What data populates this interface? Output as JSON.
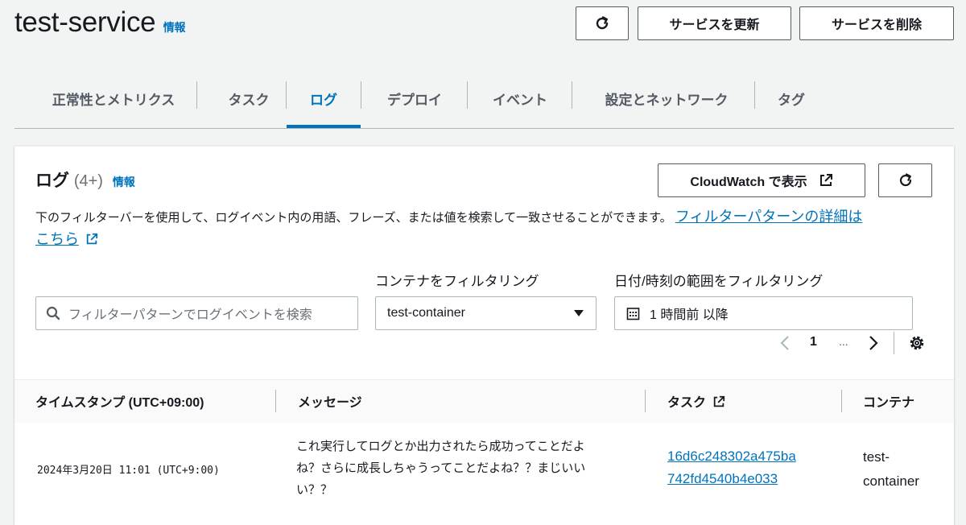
{
  "header": {
    "title": "test-service",
    "info": "情報",
    "update_button": "サービスを更新",
    "delete_button": "サービスを削除"
  },
  "tabs": [
    {
      "label": "正常性とメトリクス",
      "active": false
    },
    {
      "label": "タスク",
      "active": false
    },
    {
      "label": "ログ",
      "active": true
    },
    {
      "label": "デプロイ",
      "active": false
    },
    {
      "label": "イベント",
      "active": false
    },
    {
      "label": "設定とネットワーク",
      "active": false
    },
    {
      "label": "タグ",
      "active": false
    }
  ],
  "logs": {
    "title": "ログ",
    "count": "(4+)",
    "info": "情報",
    "cloudwatch_button": "CloudWatch で表示",
    "description": "下のフィルターバーを使用して、ログイベント内の用語、フレーズ、または値を検索して一致させることができます。",
    "details_link_part1": "フィルターパターンの詳細は",
    "details_link_part2": "こちら",
    "search_placeholder": "フィルターパターンでログイベントを検索",
    "container_filter_label": "コンテナをフィルタリング",
    "container_filter_value": "test-container",
    "date_filter_label": "日付/時刻の範囲をフィルタリング",
    "date_filter_value": "1 時間前 以降",
    "pagination": {
      "current_page": "1",
      "ellipsis": "..."
    }
  },
  "table": {
    "columns": [
      "タイムスタンプ (UTC+09:00)",
      "メッセージ",
      "タスク",
      "コンテナ"
    ],
    "rows": [
      {
        "timestamp": "2024年3月20日 11:01 (UTC+9:00)",
        "message_lines": [
          "これ実行してログとか出力されたら成功ってことだよ",
          "ね？さらに成長しちゃうってことだよね？？まじいい",
          "い？？"
        ],
        "task_lines": [
          "16d6c248302a475ba",
          "742fd4540b4e033"
        ],
        "container_lines": [
          "test-",
          "container"
        ]
      }
    ]
  },
  "colors": {
    "accent": "#0073bb",
    "text": "#16191f",
    "muted": "#545b64",
    "background": "#f2f3f3"
  },
  "icons": [
    "refresh-icon",
    "external-link-icon",
    "search-icon",
    "caret-down-icon",
    "calendar-icon",
    "chevron-left-icon",
    "chevron-right-icon",
    "settings-icon"
  ]
}
